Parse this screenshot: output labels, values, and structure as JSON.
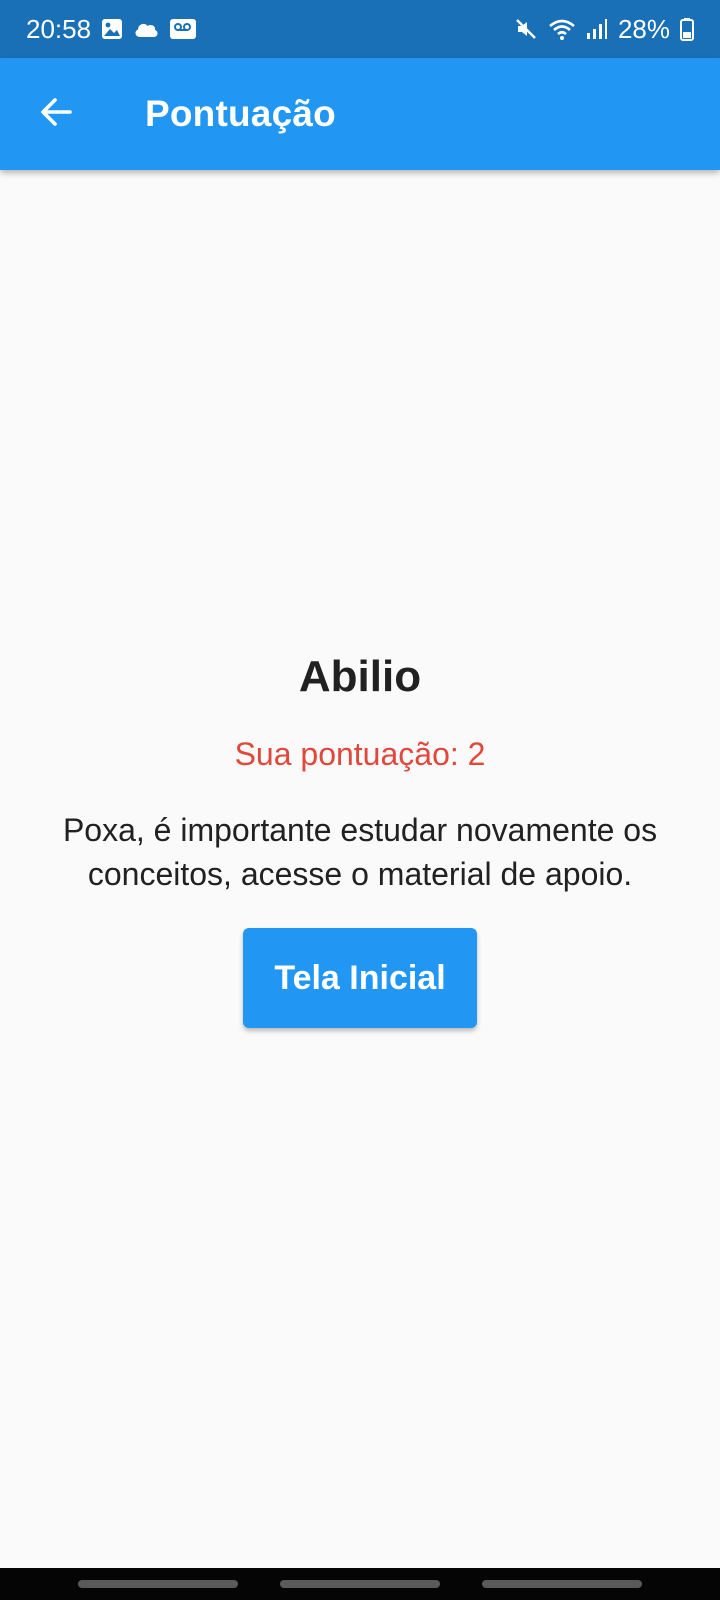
{
  "status_bar": {
    "time": "20:58",
    "battery": "28%",
    "icons_left": [
      "image-icon",
      "cloud-icon",
      "voicemail-icon"
    ],
    "icons_right": [
      "mute-icon",
      "wifi-icon",
      "signal-icon",
      "battery-icon"
    ]
  },
  "app_bar": {
    "title": "Pontuação",
    "back_icon": "arrow-back-icon",
    "color": "#2196f3"
  },
  "result": {
    "name": "Abilio",
    "score_text": "Sua pontuação: 2",
    "message": "Poxa, é importante estudar novamente os conceitos, acesse o material de apoio.",
    "score_color": "#e0483c"
  },
  "actions": {
    "home_button": "Tela Inicial"
  }
}
